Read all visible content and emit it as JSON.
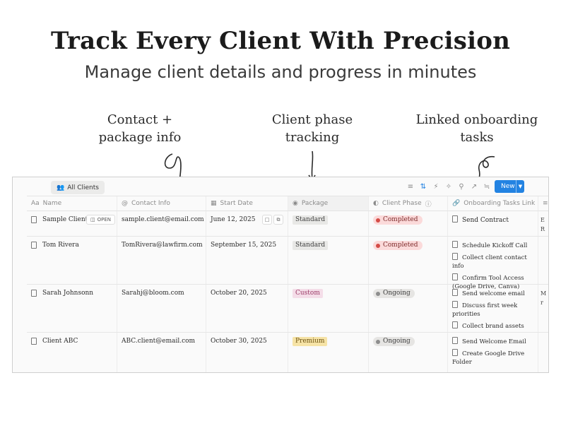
{
  "headline": "Track Every Client With Precision",
  "subline": "Manage client details and progress in minutes",
  "annotations": {
    "contact": [
      "Contact +",
      "package info"
    ],
    "phase": [
      "Client phase",
      "tracking"
    ],
    "tasks": [
      "Linked onboarding",
      "tasks"
    ]
  },
  "toolbar": {
    "view_label": "All Clients",
    "new_label": "New"
  },
  "columns": {
    "name": "Name",
    "contact": "Contact Info",
    "start": "Start Date",
    "package": "Package",
    "phase": "Client Phase",
    "tasks": "Onboarding Tasks Link"
  },
  "row_open_label": "OPEN",
  "rows": [
    {
      "name": "Sample Client",
      "contact": "sample.client@email.com",
      "start": "June 12, 2025",
      "package": "Standard",
      "phase": "Completed",
      "tasks": [
        "Send Contract"
      ],
      "extra": "E\nR"
    },
    {
      "name": "Tom Rivera",
      "contact": "TomRivera@lawfirm.com",
      "start": "September 15, 2025",
      "package": "Standard",
      "phase": "Completed",
      "tasks": [
        "Schedule Kickoff Call",
        "Collect client contact info",
        "Confirm Tool Access (Google Drive, Canva)"
      ],
      "extra": ""
    },
    {
      "name": "Sarah Johnsonn",
      "contact": "Sarahj@bloom.com",
      "start": "October 20, 2025",
      "package": "Custom",
      "phase": "Ongoing",
      "tasks": [
        "Send welcome email",
        "Discuss first week priorities",
        "Collect brand assets"
      ],
      "extra": "M\nr"
    },
    {
      "name": "Client ABC",
      "contact": "ABC.client@email.com",
      "start": "October 30, 2025",
      "package": "Premium",
      "phase": "Ongoing",
      "tasks": [
        "Send Welcome Email",
        "Create Google Drive Folder"
      ],
      "extra": ""
    }
  ],
  "colors": {
    "accent": "#2383e2",
    "completed": "#d44c47",
    "ongoing": "#8d8d8d",
    "custom_tag": "#f4dde8",
    "premium_tag": "#f6e3a6"
  }
}
